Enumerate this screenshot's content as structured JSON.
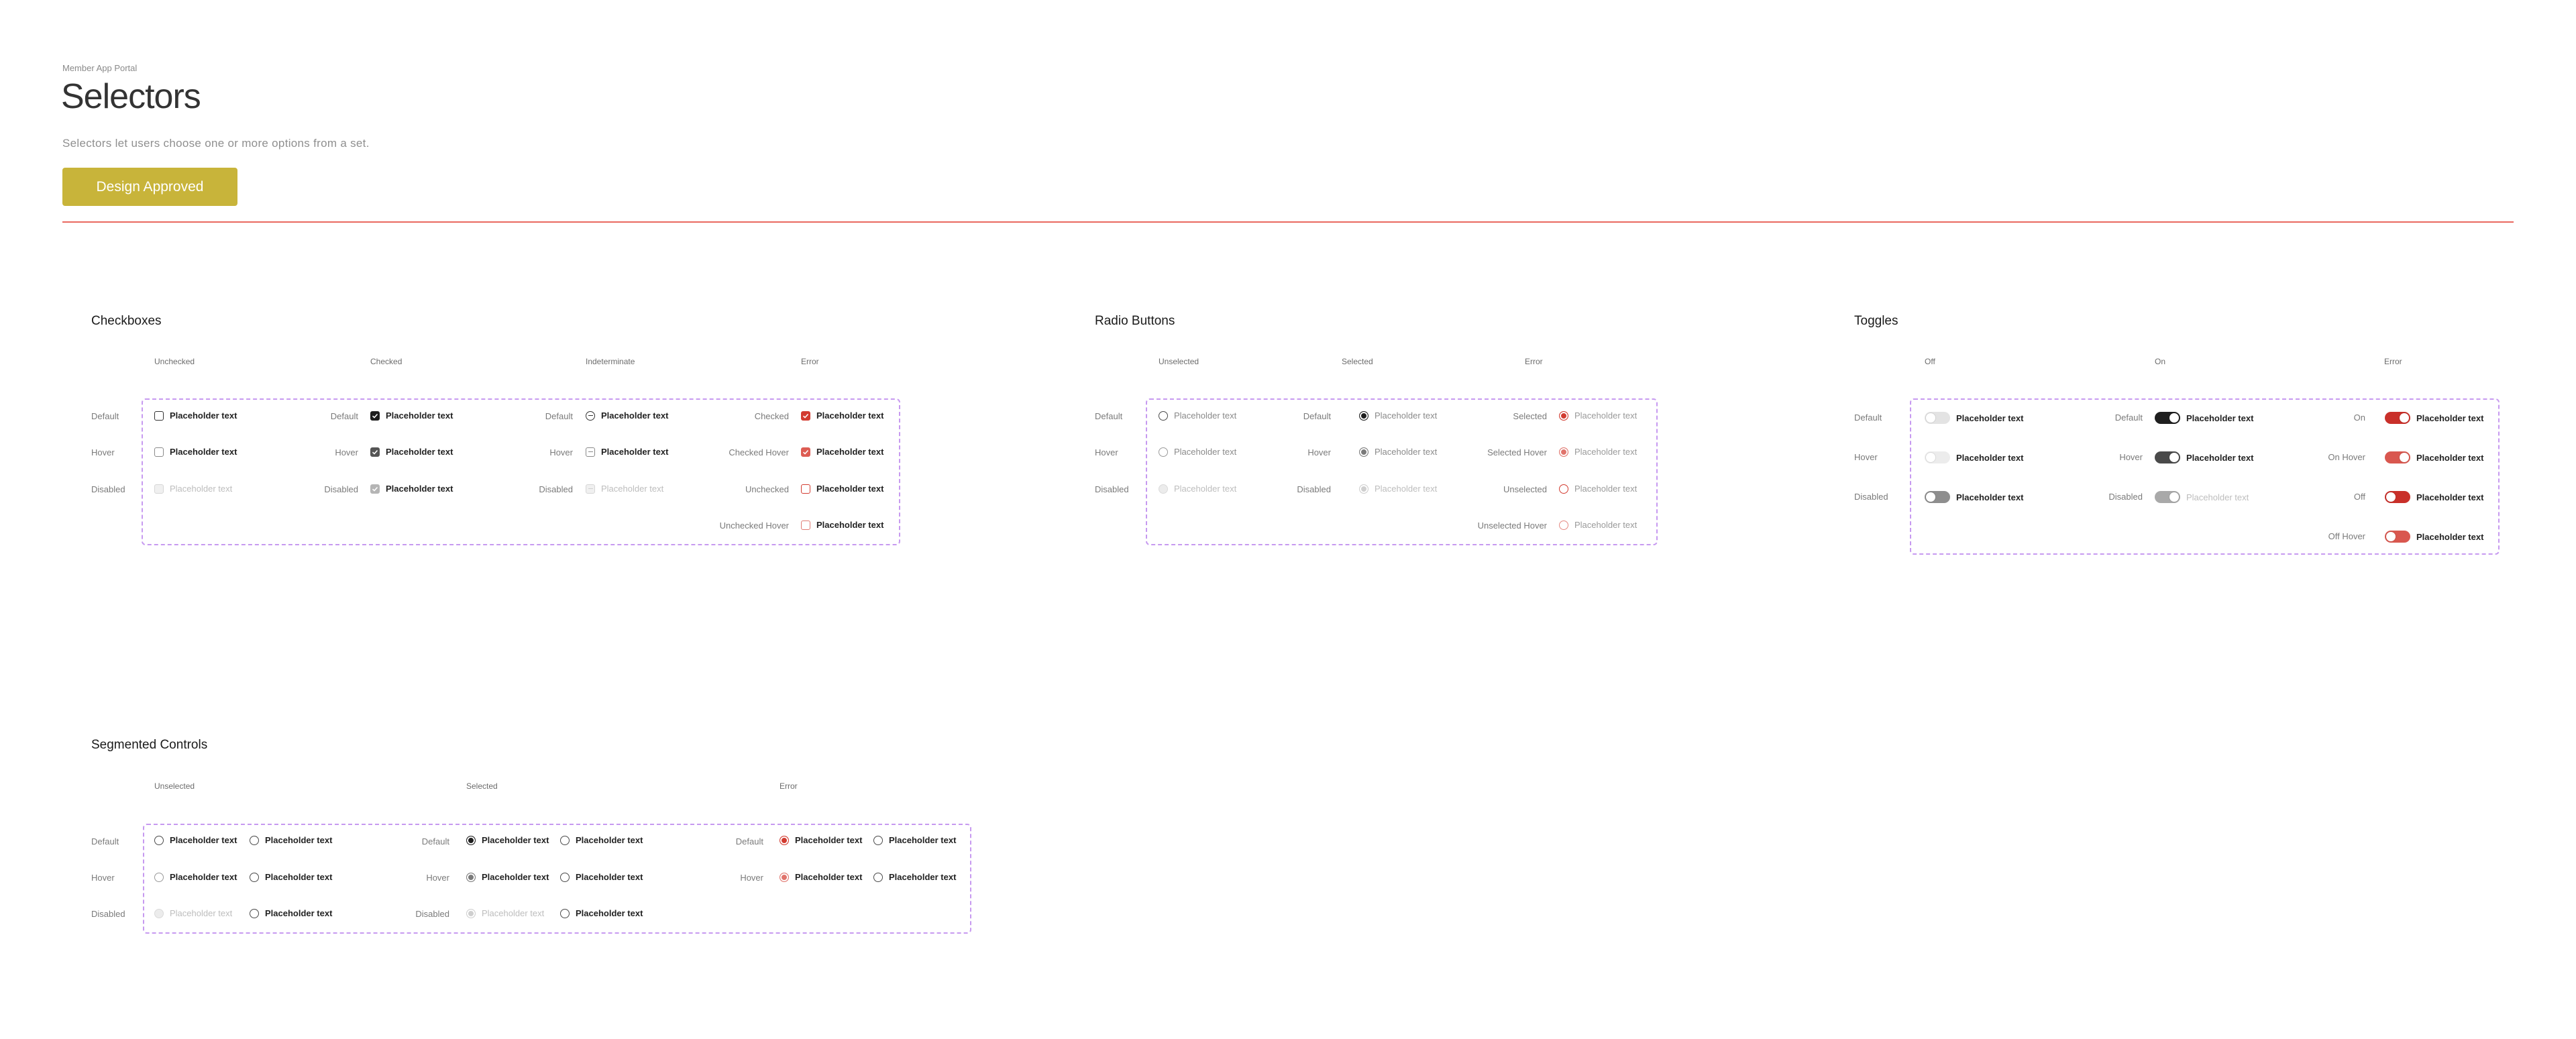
{
  "header": {
    "kicker": "Member App Portal",
    "title": "Selectors",
    "subtitle": "Selectors let users choose one or more options from a set.",
    "status_button": "Design Approved",
    "accent_color": "#c8b43a",
    "divider_color": "#e9685f"
  },
  "placeholder": "Placeholder text",
  "rows": {
    "default": "Default",
    "hover": "Hover",
    "disabled": "Disabled"
  },
  "checkboxes": {
    "title": "Checkboxes",
    "columns": {
      "unchecked": "Unchecked",
      "checked": "Checked",
      "indeterminate": "Indeterminate",
      "error": "Error"
    },
    "error_states": {
      "checked": "Checked",
      "checked_hover": "Checked Hover",
      "unchecked": "Unchecked",
      "unchecked_hover": "Unchecked Hover"
    }
  },
  "radio": {
    "title": "Radio Buttons",
    "columns": {
      "unselected": "Unselected",
      "selected": "Selected",
      "error": "Error"
    },
    "error_states": {
      "selected": "Selected",
      "selected_hover": "Selected Hover",
      "unselected": "Unselected",
      "unselected_hover": "Unselected Hover"
    }
  },
  "toggles": {
    "title": "Toggles",
    "columns": {
      "off": "Off",
      "on": "On",
      "error": "Error"
    },
    "error_states": {
      "on": "On",
      "on_hover": "On Hover",
      "off": "Off",
      "off_hover": "Off Hover"
    }
  },
  "segmented": {
    "title": "Segmented Controls",
    "columns": {
      "unselected": "Unselected",
      "selected": "Selected",
      "error": "Error"
    }
  },
  "colors": {
    "error": "#d23b30",
    "frame": "#c79af0",
    "selected": "#1e1e1e"
  }
}
